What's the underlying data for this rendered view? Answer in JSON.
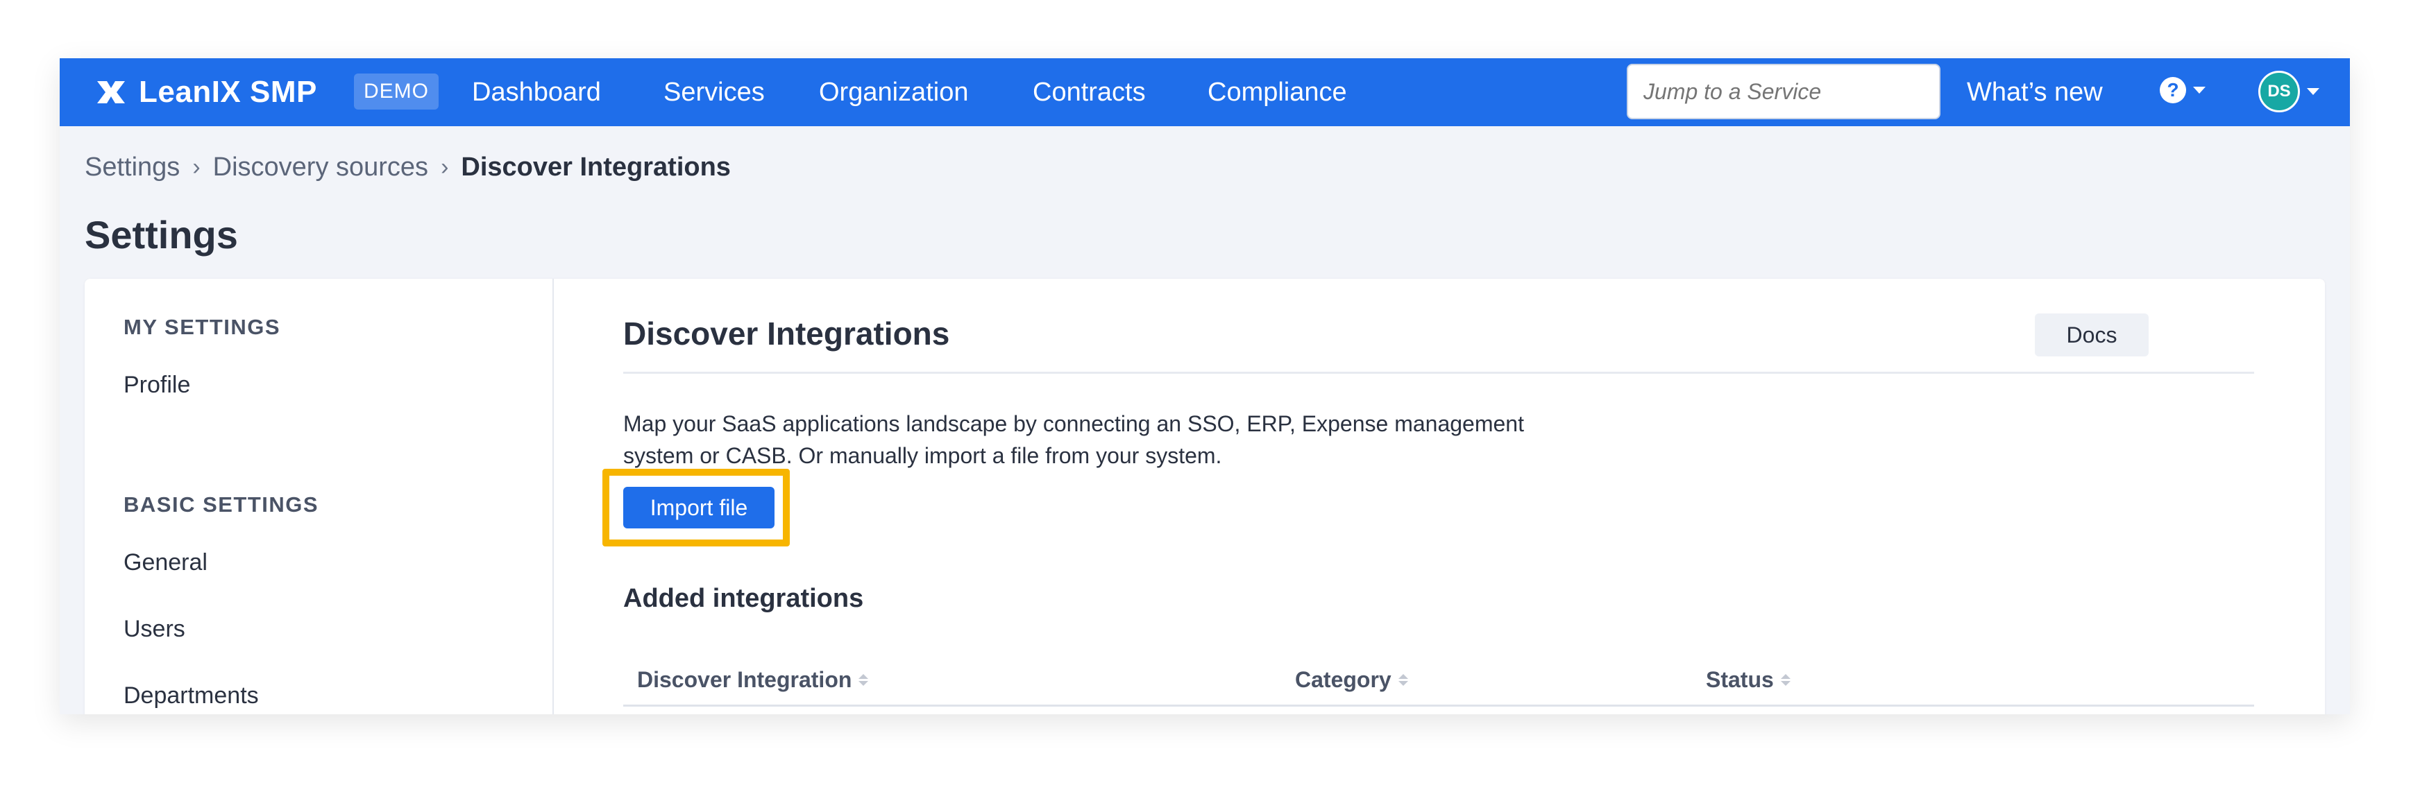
{
  "topbar": {
    "brand": "LeanIX SMP",
    "badge": "DEMO",
    "nav": [
      "Dashboard",
      "Services",
      "Organization",
      "Contracts",
      "Compliance"
    ],
    "search_placeholder": "Jump to a Service",
    "whats_new": "What’s new",
    "help_glyph": "?",
    "avatar_initials": "DS",
    "color": "#1f6eea"
  },
  "breadcrumb": {
    "items": [
      "Settings",
      "Discovery sources"
    ],
    "current": "Discover Integrations",
    "separator": "›"
  },
  "page_title": "Settings",
  "sidebar": {
    "sections": [
      {
        "heading": "MY SETTINGS",
        "items": [
          "Profile"
        ]
      },
      {
        "heading": "BASIC SETTINGS",
        "items": [
          "General",
          "Users",
          "Departments"
        ]
      }
    ]
  },
  "main": {
    "title": "Discover Integrations",
    "docs_label": "Docs",
    "description": "Map your SaaS applications landscape by connecting an SSO, ERP, Expense management system or CASB. Or manually import a file from your system.",
    "import_label": "Import file",
    "highlight_color": "#f7b500",
    "added_title": "Added integrations",
    "columns": [
      "Discover Integration",
      "Category",
      "Status"
    ]
  }
}
